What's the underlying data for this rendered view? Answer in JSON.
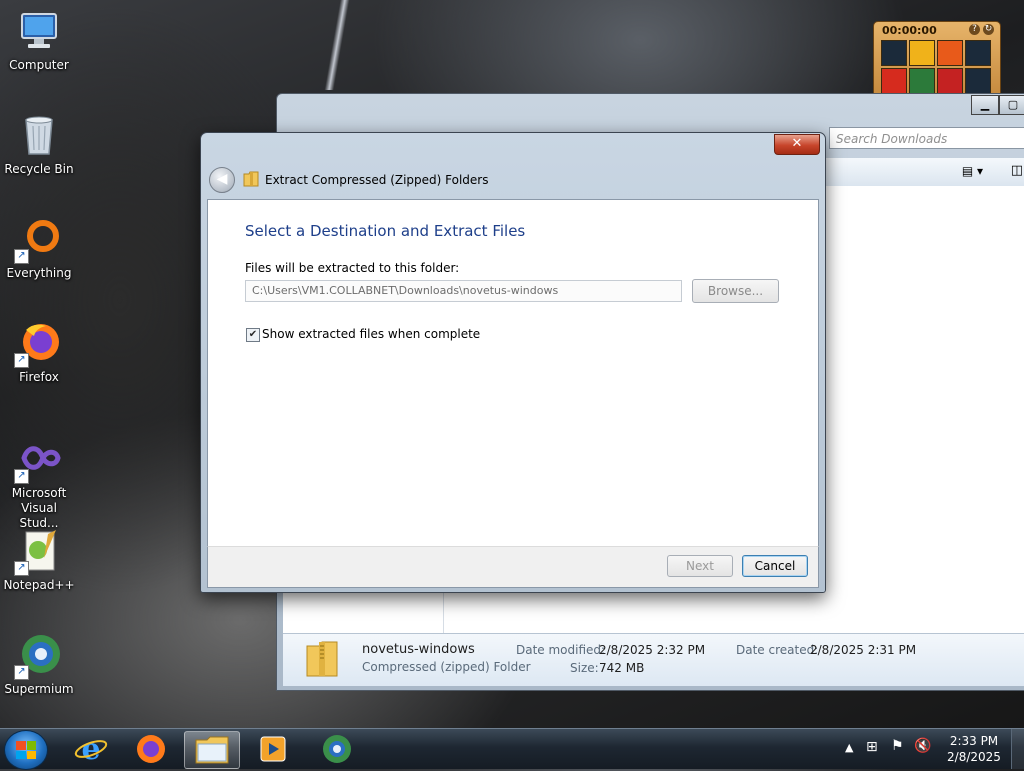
{
  "desktop": {
    "icons": [
      {
        "label": "Computer",
        "icon": "computer-icon"
      },
      {
        "label": "Recycle Bin",
        "icon": "recycle-bin-icon"
      },
      {
        "label": "Everything",
        "icon": "everything-icon"
      },
      {
        "label": "Firefox",
        "icon": "firefox-icon"
      },
      {
        "label": "Microsoft Visual Stud...",
        "icon": "visual-studio-icon"
      },
      {
        "label": "Notepad++",
        "icon": "notepadpp-icon"
      },
      {
        "label": "Supermium",
        "icon": "supermium-icon"
      }
    ]
  },
  "explorer": {
    "search_placeholder": "Search Downloads",
    "file": {
      "name": "novetus-windows",
      "type": "Compressed (zipped) Folder",
      "date_modified_label": "Date modified:",
      "date_modified": "2/8/2025 2:32 PM",
      "date_created_label": "Date created:",
      "date_created": "2/8/2025 2:31 PM",
      "size_label": "Size:",
      "size": "742 MB"
    }
  },
  "dialog": {
    "title": "Extract Compressed (Zipped) Folders",
    "close_glyph": "✕",
    "heading": "Select a Destination and Extract Files",
    "dest_label": "Files will be extracted to this folder:",
    "dest_path": "C:\\Users\\VM1.COLLABNET\\Downloads\\novetus-windows",
    "browse_label": "Browse...",
    "show_files_label": "Show extracted files when complete",
    "show_files_checked": true,
    "next_label": "Next",
    "cancel_label": "Cancel"
  },
  "gadget": {
    "time": "00:00:00",
    "tiles": [
      "#1b2a3a",
      "#f0b21a",
      "#e85a1a",
      "#1b2a3a",
      "#d62b1e",
      "#2c7a3a",
      "#c42222",
      "#1b2a3a",
      "#2a6a30",
      "#e9d8a0",
      "#1b2a3a",
      "#f2c230"
    ]
  },
  "taskbar": {
    "pinned": [
      {
        "name": "ie-icon"
      },
      {
        "name": "firefox-icon"
      },
      {
        "name": "file-explorer-icon",
        "active": true
      },
      {
        "name": "media-player-icon"
      },
      {
        "name": "supermium-icon"
      }
    ],
    "clock_time": "2:33 PM",
    "clock_date": "2/8/2025"
  },
  "colors": {
    "heading_blue": "#1e3f8a",
    "close_red": "#c7452b",
    "taskbar_dark": "#1e2732"
  }
}
